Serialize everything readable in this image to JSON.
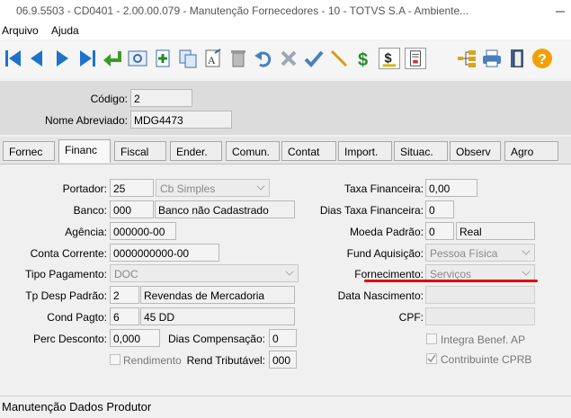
{
  "window": {
    "title": "06.9.5503 - CD0401 - 2.00.00.079 - Manutenção Fornecedores - 10 - TOTVS S.A - Ambiente..."
  },
  "menu": {
    "arquivo": "Arquivo",
    "ajuda": "Ajuda"
  },
  "toolbar": {
    "icons": [
      "first-icon",
      "prev-icon",
      "next-icon",
      "last-icon",
      "goto-icon",
      "search-icon",
      "add-icon",
      "copy-icon",
      "edit-icon",
      "delete-icon",
      "undo-icon",
      "cancel-icon",
      "confirm-icon",
      "pencil-icon",
      "dollar-icon",
      "dollar-doc-icon",
      "report-icon",
      "navigation-icon",
      "print-icon",
      "exit-icon",
      "help-icon"
    ]
  },
  "header": {
    "codigo_label": "Código:",
    "codigo_value": "2",
    "nome_label": "Nome Abreviado:",
    "nome_value": "MDG4473"
  },
  "tabs": [
    "Fornec",
    "Financ",
    "Fiscal",
    "Ender.",
    "Comun.",
    "Contat",
    "Import.",
    "Situac.",
    "Observ",
    "Agro"
  ],
  "active_tab": "Financ",
  "form": {
    "portador_label": "Portador:",
    "portador_value": "25",
    "portador_combo": "Cb Simples",
    "banco_label": "Banco:",
    "banco_value": "000",
    "banco_desc": "Banco não Cadastrado",
    "agencia_label": "Agência:",
    "agencia_value": "000000-00",
    "conta_label": "Conta Corrente:",
    "conta_value": "0000000000-00",
    "tipo_pag_label": "Tipo Pagamento:",
    "tipo_pag_value": "DOC",
    "tp_desp_label": "Tp Desp Padrão:",
    "tp_desp_value": "2",
    "tp_desp_desc": "Revendas de Mercadoria",
    "cond_label": "Cond Pagto:",
    "cond_value": "6",
    "cond_desc": "45 DD",
    "perc_label": "Perc Desconto:",
    "perc_value": "0,000",
    "dias_comp_label": "Dias Compensação:",
    "dias_comp_value": "0",
    "rendimento_label": "Rendimento",
    "rend_trib_label": "Rend Tributável:",
    "rend_trib_value": "000",
    "taxa_fin_label": "Taxa Financeira:",
    "taxa_fin_value": "0,00",
    "dias_taxa_label": "Dias Taxa Financeira:",
    "dias_taxa_value": "0",
    "moeda_label": "Moeda Padrão:",
    "moeda_value": "0",
    "moeda_desc": "Real",
    "fund_label": "Fund Aquisição:",
    "fund_value": "Pessoa Física",
    "fornecimento_label": "Fornecimento:",
    "fornecimento_value": "Serviços",
    "data_nasc_label": "Data Nascimento:",
    "data_nasc_value": "",
    "cpf_label": "CPF:",
    "cpf_value": "",
    "integra_label": "Integra Benef. AP",
    "contribuinte_label": "Contribuinte CPRB",
    "contribuinte_checked": true
  },
  "status": {
    "text": "Manutenção Dados Produtor"
  },
  "colors": {
    "annotation_underline": "#e00000",
    "toolbar_blue": "#1e73c8"
  }
}
